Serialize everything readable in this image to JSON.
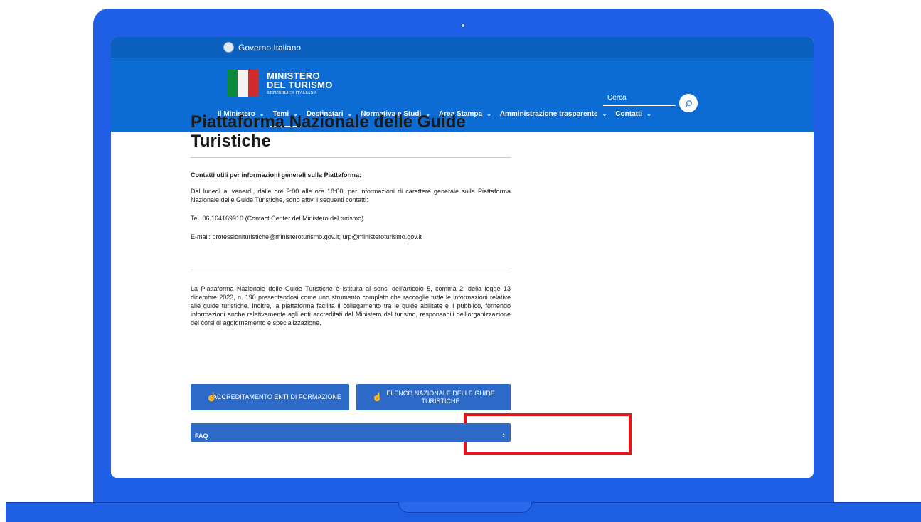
{
  "gov_bar": {
    "label": "Governo Italiano"
  },
  "logo": {
    "line1": "MINISTERO",
    "line2": "DEL TURISMO",
    "line3": "REPUBBLICA ITALIANA"
  },
  "search": {
    "placeholder": "Cerca",
    "icon": "search-icon"
  },
  "nav": {
    "items": [
      {
        "label": "Il Ministero"
      },
      {
        "label": "Temi"
      },
      {
        "label": "Destinatari"
      },
      {
        "label": "Normativa e Studi"
      },
      {
        "label": "Area Stampa"
      },
      {
        "label": "Amministrazione trasparente"
      },
      {
        "label": "Contatti"
      }
    ],
    "active": "Temi"
  },
  "page": {
    "title": "Piattaforma Nazionale delle Guide Turistiche",
    "contacts_heading": "Contatti utili per informazioni generali sulla Piattaforma:",
    "contacts_hours": "Dal lunedì al venerdì, dalle ore 9:00 alle ore 18:00, per informazioni di carattere generale sulla Piattaforma Nazionale delle Guide Turistiche, sono attivi i seguenti contatti:",
    "phone": "Tel. 06.164169910 (Contact Center del Ministero del turismo)",
    "email": "E-mail: professionituristiche@ministeroturismo.gov.it; urp@ministeroturismo.gov.it",
    "intro": "La Piattaforma Nazionale delle Guide Turistiche è istituita ai sensi dell'articolo 5, comma 2, della legge 13 dicembre 2023, n. 190 presentandosi come uno strumento completo che raccoglie tutte le informazioni relative alle guide turistiche. Inoltre, la piattaforma facilita il collegamento tra le guide abilitate e il pubblico, fornendo informazioni anche relativamente agli enti accreditati dal Ministero del turismo, responsabili dell'organizzazione dei corsi di aggiornamento e specializzazione."
  },
  "buttons": {
    "accreditamento": "ACCREDITAMENTO ENTI DI FORMAZIONE",
    "elenco": "ELENCO NAZIONALE DELLE GUIDE TURISTICHE",
    "faq": "FAQ"
  },
  "colors": {
    "header_blue": "#0d6bd4",
    "button_blue": "#2d69c7",
    "highlight_red": "#e8141b",
    "laptop_blue": "#1f5fe6"
  }
}
